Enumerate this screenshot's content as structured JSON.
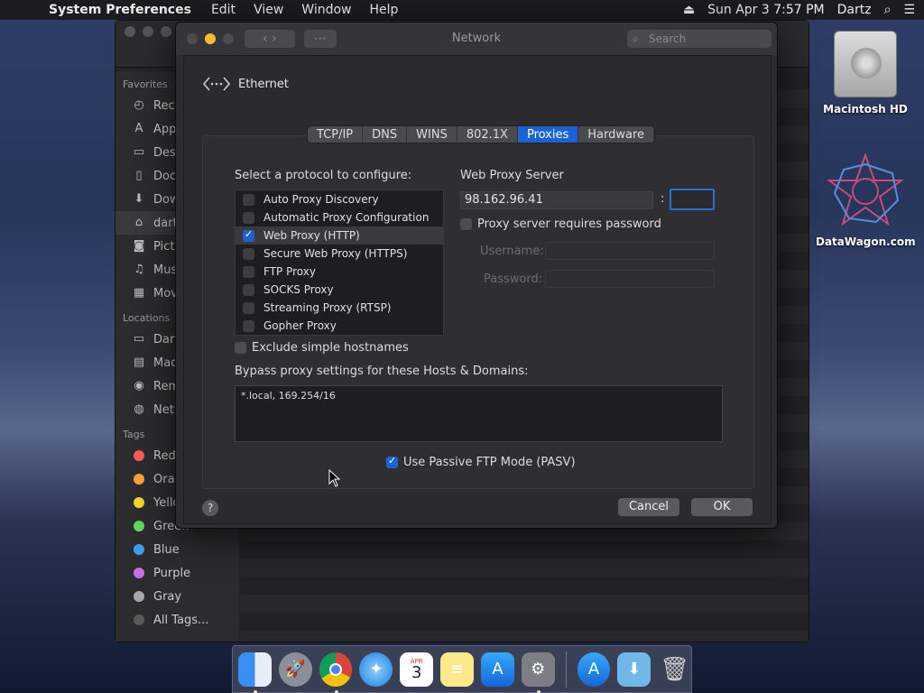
{
  "menubar": {
    "app_name": "System Preferences",
    "menus": [
      "Edit",
      "View",
      "Window",
      "Help"
    ],
    "clock": "Sun Apr 3  7:57 PM",
    "user": "Dartz"
  },
  "desktop": {
    "hd_label": "Macintosh HD",
    "site_label": "DataWagon.com"
  },
  "finder": {
    "favorites_heading": "Favorites",
    "favorites": [
      "Rece",
      "App",
      "Des",
      "Doc",
      "Dow",
      "dartz",
      "Pict",
      "Mus",
      "Mov"
    ],
    "locations_heading": "Locations",
    "locations": [
      "Dart",
      "Mac",
      "Rem",
      "Netw"
    ],
    "tags_heading": "Tags",
    "tags": [
      {
        "label": "Red",
        "color": "#ff5b57"
      },
      {
        "label": "Orange",
        "color": "#f7a23b"
      },
      {
        "label": "Yellow",
        "color": "#f5d329"
      },
      {
        "label": "Green",
        "color": "#5dd95b"
      },
      {
        "label": "Blue",
        "color": "#3f9cf6"
      },
      {
        "label": "Purple",
        "color": "#c36ee6"
      },
      {
        "label": "Gray",
        "color": "#a8a8a8"
      },
      {
        "label": "All Tags...",
        "color": "#5a5a5a"
      }
    ]
  },
  "window": {
    "title": "Network",
    "search_placeholder": "Search"
  },
  "sheet": {
    "interface": "Ethernet",
    "tabs": [
      "TCP/IP",
      "DNS",
      "WINS",
      "802.1X",
      "Proxies",
      "Hardware"
    ],
    "active_tab": "Proxies",
    "protocol_heading": "Select a protocol to configure:",
    "protocols": [
      {
        "label": "Auto Proxy Discovery",
        "checked": false
      },
      {
        "label": "Automatic Proxy Configuration",
        "checked": false
      },
      {
        "label": "Web Proxy (HTTP)",
        "checked": true
      },
      {
        "label": "Secure Web Proxy (HTTPS)",
        "checked": false
      },
      {
        "label": "FTP Proxy",
        "checked": false
      },
      {
        "label": "SOCKS Proxy",
        "checked": false
      },
      {
        "label": "Streaming Proxy (RTSP)",
        "checked": false
      },
      {
        "label": "Gopher Proxy",
        "checked": false
      }
    ],
    "server_heading": "Web Proxy Server",
    "server_address": "98.162.96.41",
    "port_separator": ":",
    "port_value": "",
    "password_check_label": "Proxy server requires password",
    "password_required": false,
    "username_label": "Username:",
    "password_label": "Password:",
    "exclude_label": "Exclude simple hostnames",
    "exclude_checked": false,
    "bypass_heading": "Bypass proxy settings for these Hosts & Domains:",
    "bypass_value": "*.local, 169.254/16",
    "pasv_label": "Use Passive FTP Mode (PASV)",
    "pasv_checked": true,
    "help_label": "?",
    "cancel_label": "Cancel",
    "ok_label": "OK"
  },
  "dock": {
    "calendar_month": "APR",
    "calendar_day": "3"
  },
  "colors": {
    "accent": "#1b63d4"
  }
}
